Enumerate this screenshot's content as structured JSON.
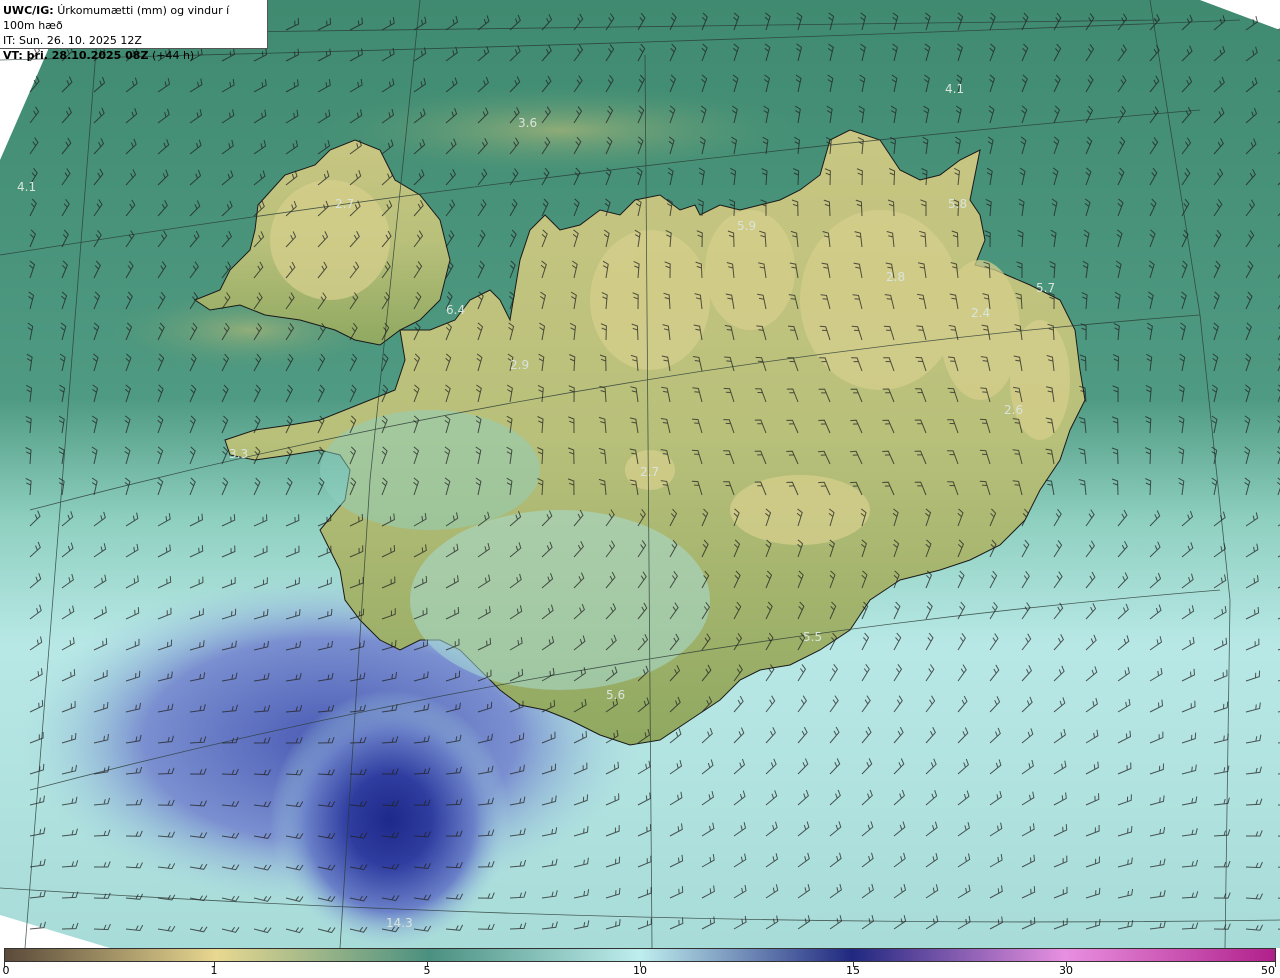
{
  "header": {
    "title_prefix": "UWC/IG:",
    "title": "Úrkomumætti (mm) og vindur í 100m hæð",
    "issue_time": "IT: Sun. 26. 10. 2025 12Z",
    "valid_prefix": "VT: þri. 28.10.2025 08Z",
    "valid_offset": "(+44 h)"
  },
  "legend": {
    "ticks": [
      "0",
      "1",
      "5",
      "10",
      "15",
      "30",
      "50"
    ],
    "colors": [
      "#5a4a3a",
      "#e8d890",
      "#4a9080",
      "#bfeeee",
      "#202880",
      "#e890e0",
      "#b0208a"
    ]
  },
  "value_labels": [
    "3.6",
    "4.1",
    "4.1",
    "2.7",
    "5.9",
    "5.8",
    "5.7",
    "6.4",
    "2.8",
    "2.4",
    "2.9",
    "2.6",
    "3.3",
    "2.7",
    "5.5",
    "5.6",
    "14.3"
  ],
  "colors": {
    "land_low": "#8fa860",
    "land_high": "#d8d08a",
    "sea_green": "#3f8a70",
    "sea_light": "#aee4e2",
    "sea_blue": "#3a4aa8",
    "sea_deep": "#222a8c",
    "barb": "#222222"
  }
}
